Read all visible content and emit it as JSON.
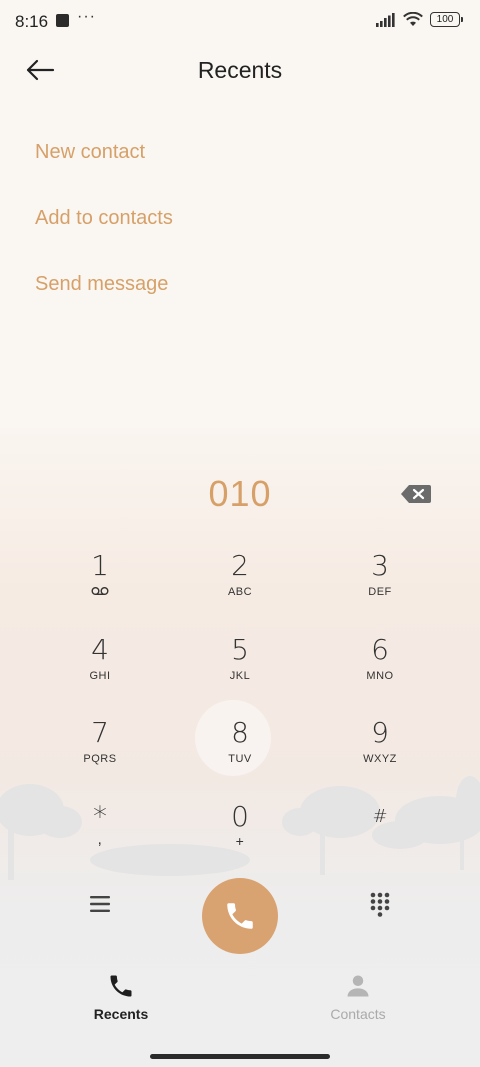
{
  "status_bar": {
    "time": "8:16",
    "dots": "···",
    "battery": "100",
    "icons": [
      "notification-square-icon",
      "cellular-signal-icon",
      "wifi-icon",
      "battery-icon"
    ]
  },
  "header": {
    "title": "Recents",
    "back_icon": "back-arrow-icon"
  },
  "options": [
    {
      "label": "New contact"
    },
    {
      "label": "Add to contacts"
    },
    {
      "label": "Send message"
    }
  ],
  "dialer": {
    "number": "010",
    "backspace_icon": "backspace-icon",
    "keys": [
      {
        "digit": "1",
        "letters": ""
      },
      {
        "digit": "2",
        "letters": "ABC"
      },
      {
        "digit": "3",
        "letters": "DEF"
      },
      {
        "digit": "4",
        "letters": "GHI"
      },
      {
        "digit": "5",
        "letters": "JKL"
      },
      {
        "digit": "6",
        "letters": "MNO"
      },
      {
        "digit": "7",
        "letters": "PQRS"
      },
      {
        "digit": "8",
        "letters": "TUV"
      },
      {
        "digit": "9",
        "letters": "WXYZ"
      },
      {
        "digit": "*",
        "letters": ","
      },
      {
        "digit": "0",
        "letters": "+"
      },
      {
        "digit": "#",
        "letters": ""
      }
    ]
  },
  "actions": {
    "menu_icon": "menu-icon",
    "call_icon": "phone-icon",
    "keypad_icon": "dialpad-icon"
  },
  "bottom_nav": {
    "tabs": [
      {
        "label": "Recents",
        "icon": "phone-icon",
        "active": true
      },
      {
        "label": "Contacts",
        "icon": "person-icon",
        "active": false
      }
    ]
  },
  "colors": {
    "accent": "#d6a068",
    "call_button": "#d9a271",
    "background": "#faf7f3",
    "inactive_tab": "#aaaaaa"
  }
}
